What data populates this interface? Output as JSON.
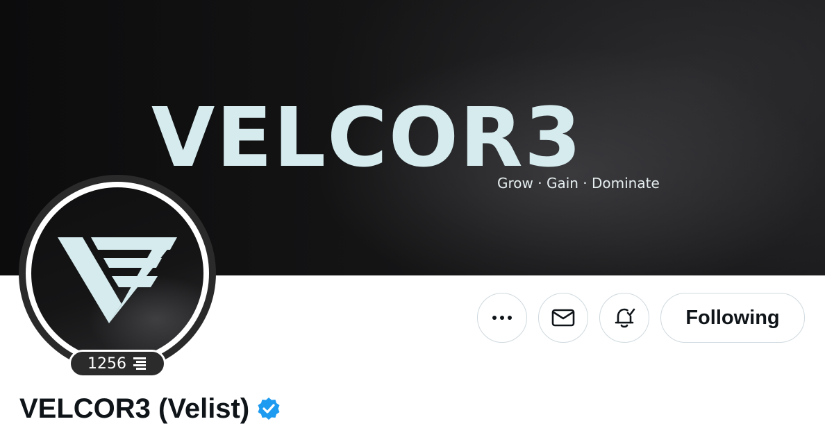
{
  "banner": {
    "title": "VELCOR3",
    "tagline": "Grow · Gain · Dominate"
  },
  "profile": {
    "badge_count": "1256",
    "display_name": "VELCOR3 (Velist)",
    "verified": true
  },
  "actions": {
    "more_icon": "more-horizontal-icon",
    "message_icon": "envelope-icon",
    "notify_icon": "bell-check-icon",
    "follow_label": "Following"
  },
  "colors": {
    "brand_light": "#d5ebee",
    "verified_blue": "#1d9bf0",
    "text_primary": "#0f1419",
    "button_border": "#cfd9de"
  }
}
